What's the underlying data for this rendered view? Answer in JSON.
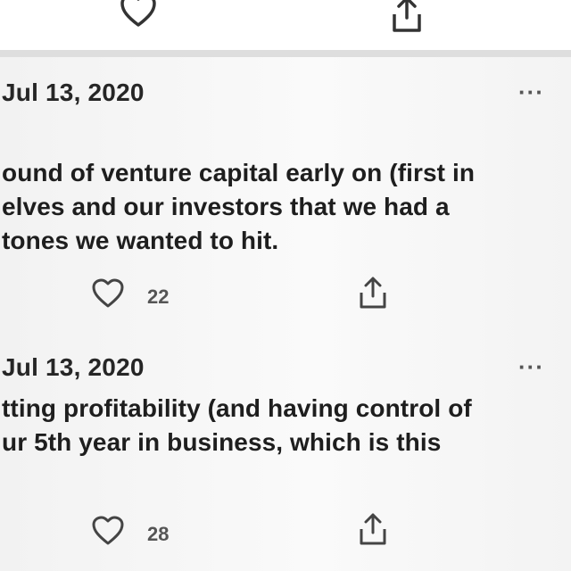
{
  "icons": {
    "like": "heart-icon",
    "share": "share-icon",
    "more": "ellipsis-icon"
  },
  "colors": {
    "text": "#1e1e1e",
    "muted": "#555555",
    "separator": "#dedede"
  },
  "posts": [
    {
      "date": "Jul 13, 2020",
      "more": "···",
      "lines": [
        "ound of venture capital early on (first in",
        "elves and our investors that we had a",
        "tones we wanted to hit."
      ],
      "likes": "22"
    },
    {
      "date": "Jul 13, 2020",
      "more": "···",
      "lines": [
        "tting profitability (and having control of",
        "ur 5th year in business, which is this"
      ],
      "likes": "28"
    }
  ]
}
